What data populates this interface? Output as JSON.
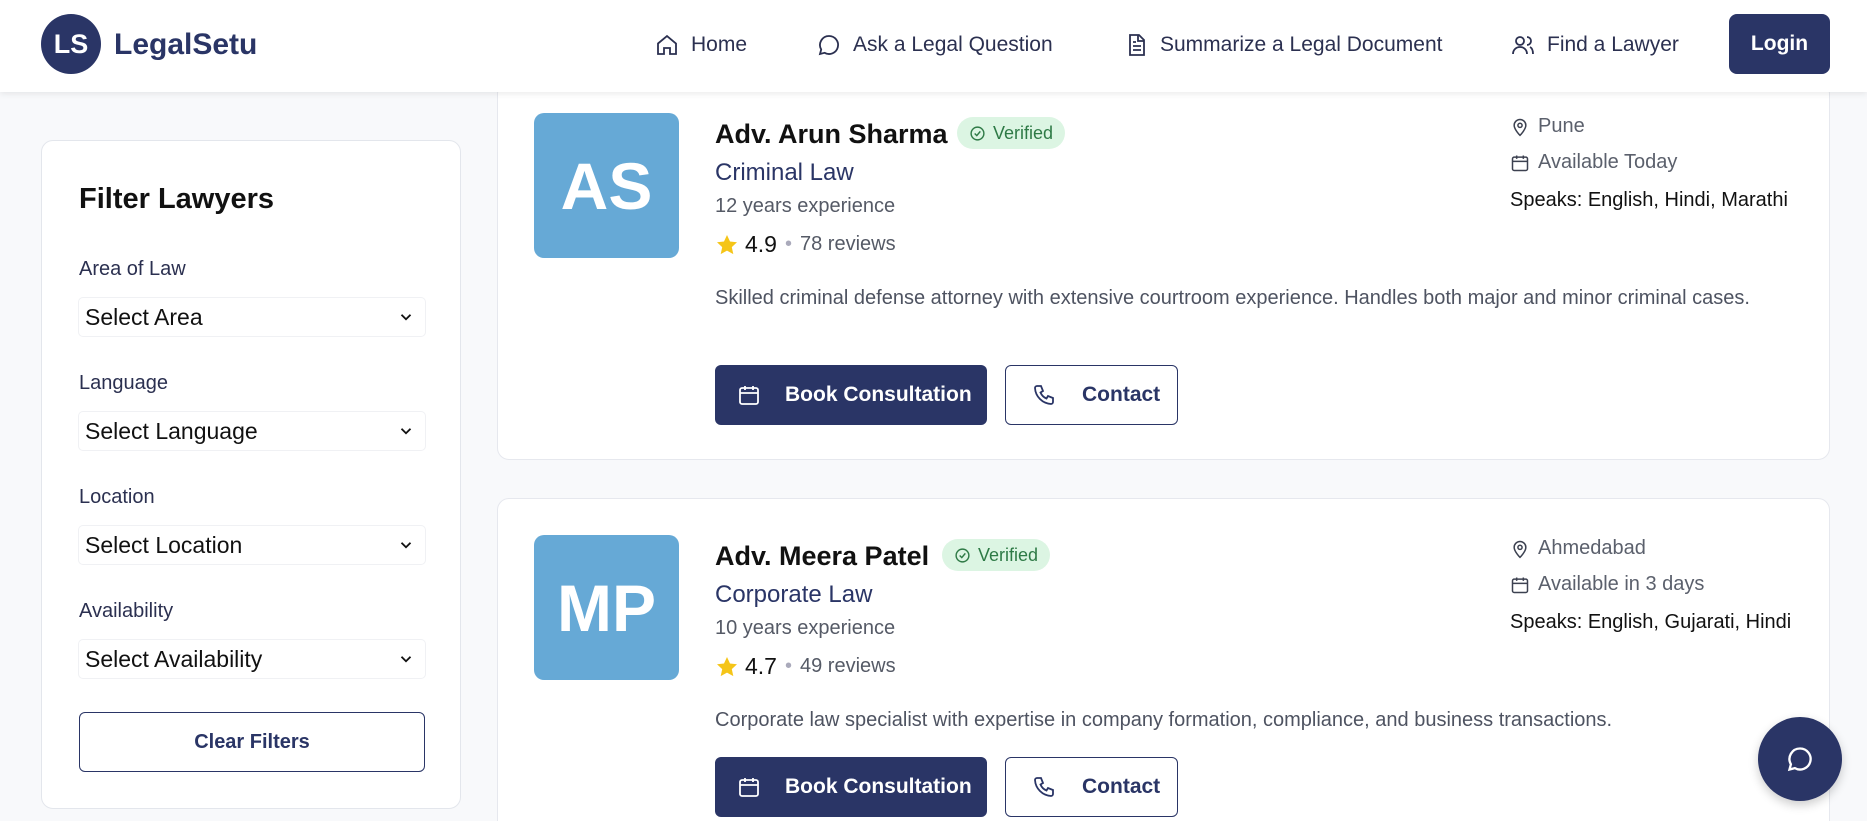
{
  "header": {
    "logo_initials": "LS",
    "brand": "LegalSetu",
    "nav": [
      {
        "label": "Home",
        "icon": "home-icon"
      },
      {
        "label": "Ask a Legal Question",
        "icon": "chat-icon"
      },
      {
        "label": "Summarize a Legal Document",
        "icon": "document-icon"
      },
      {
        "label": "Find a Lawyer",
        "icon": "users-icon"
      }
    ],
    "login_label": "Login"
  },
  "filters": {
    "title": "Filter Lawyers",
    "area_label": "Area of Law",
    "area_value": "Select Area",
    "language_label": "Language",
    "language_value": "Select Language",
    "location_label": "Location",
    "location_value": "Select Location",
    "availability_label": "Availability",
    "availability_value": "Select Availability",
    "clear_label": "Clear Filters"
  },
  "lawyers": [
    {
      "initials": "AS",
      "name": "Adv. Arun Sharma",
      "verified_label": "Verified",
      "specialty": "Criminal Law",
      "experience": "12 years experience",
      "rating": "4.9",
      "reviews": "78 reviews",
      "description": "Skilled criminal defense attorney with extensive courtroom experience. Handles both major and minor criminal cases.",
      "location": "Pune",
      "availability": "Available Today",
      "speaks": "Speaks: English, Hindi, Marathi",
      "book_label": "Book Consultation",
      "contact_label": "Contact"
    },
    {
      "initials": "MP",
      "name": "Adv. Meera Patel",
      "verified_label": "Verified",
      "specialty": "Corporate Law",
      "experience": "10 years experience",
      "rating": "4.7",
      "reviews": "49 reviews",
      "description": "Corporate law specialist with expertise in company formation, compliance, and business transactions.",
      "location": "Ahmedabad",
      "availability": "Available in 3 days",
      "speaks": "Speaks: English, Gujarati, Hindi",
      "book_label": "Book Consultation",
      "contact_label": "Contact"
    }
  ],
  "colors": {
    "primary": "#2a3566",
    "avatar": "#66a9d6",
    "verified_bg": "#dcf5e3",
    "verified_text": "#2e7a46",
    "star": "#f5c518"
  }
}
